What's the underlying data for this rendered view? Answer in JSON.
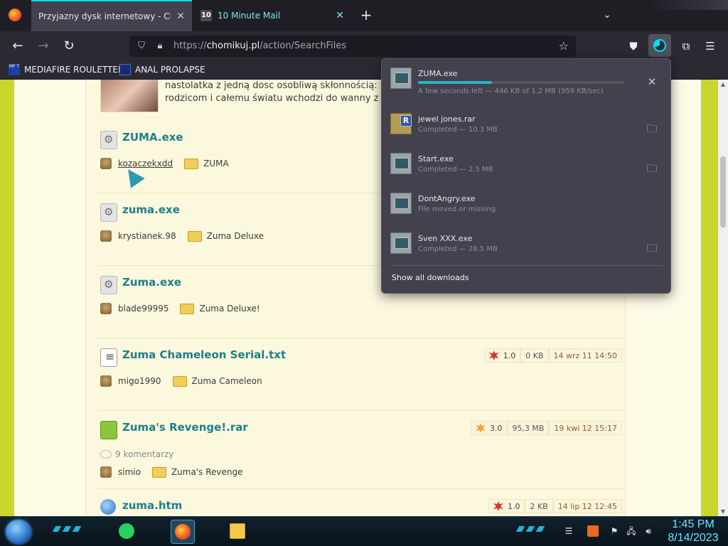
{
  "browser": {
    "tabs": [
      {
        "title": "Przyjazny dysk internetowy - Chom",
        "close": "✕"
      },
      {
        "title": "10 Minute Mail",
        "favicon_text": "10",
        "close": "✕"
      }
    ],
    "new_tab": "+",
    "url": {
      "prefix": "https://",
      "host": "chomikuj.pl",
      "path": "/action/SearchFiles"
    },
    "bookmarks": [
      {
        "label": "MEDIAFIRE ROULETTER",
        "icon_text": "MF T"
      },
      {
        "label": "ANAL PROLAPSE"
      }
    ]
  },
  "page": {
    "intro_lines": [
      "nastolatka z jedną dosc osobliwą skłonnością: k",
      "rodzicom i całemu światu wchodzi do wanny z k"
    ],
    "files": [
      {
        "name": "ZUMA.exe",
        "type": "exe",
        "user": "kozaczekxdd",
        "folder": "ZUMA"
      },
      {
        "name": "zuma.exe",
        "type": "exe",
        "user": "krystianek.98",
        "folder": "Zuma Deluxe"
      },
      {
        "name": "Zuma.exe",
        "type": "exe",
        "user": "blade99995",
        "folder": "Zuma Deluxe!"
      },
      {
        "name": "Zuma Chameleon Serial.txt",
        "type": "txt",
        "user": "migo1990",
        "folder": "Zuma Cameleon",
        "rating": "1.0",
        "size": "0 KB",
        "date": "14 wrz 11 14:50"
      },
      {
        "name": "Zuma's Revenge!.rar",
        "type": "rar",
        "user": "simio",
        "folder": "Zuma's Revenge",
        "rating": "3.0",
        "size": "95,3 MB",
        "date": "19 kwi 12 15:17",
        "comments": "9 komentarzy"
      },
      {
        "name": "zuma.htm",
        "type": "htm",
        "rating": "1.0",
        "size": "2 KB",
        "date": "14 lip 12 12:45"
      }
    ]
  },
  "downloads": {
    "items": [
      {
        "name": "ZUMA.exe",
        "status": "A few seconds left — 446 KB of 1.2 MB (959 KB/sec)",
        "progress": 0.36,
        "action": "cancel"
      },
      {
        "name": "jewel jones.rar",
        "status": "Completed — 10.3 MB",
        "action": "open-folder"
      },
      {
        "name": "Start.exe",
        "status": "Completed — 2.5 MB",
        "action": "open-folder"
      },
      {
        "name": "DontAngry.exe",
        "status": "File moved or missing"
      },
      {
        "name": "Sven XXX.exe",
        "status": "Completed — 28.5 MB",
        "action": "open-folder"
      }
    ],
    "show_all": "Show all downloads"
  },
  "taskbar": {
    "time": "1:45 PM",
    "date": "8/14/2023"
  },
  "colors": {
    "accent": "#00ddff",
    "link": "#1d7f8b",
    "page_bg": "#c8d72a"
  }
}
